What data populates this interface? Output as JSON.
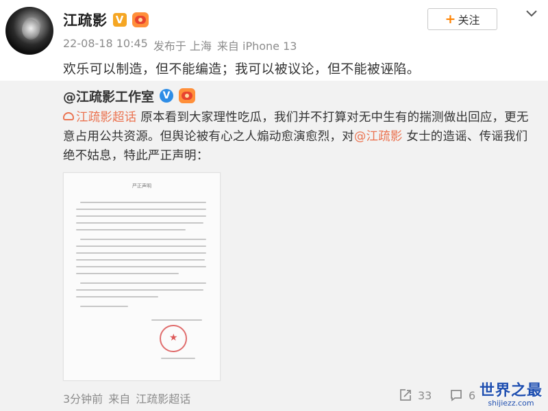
{
  "post": {
    "author": "江疏影",
    "verified_icon": "orange-v-badge",
    "level_icon": "svip-badge",
    "date": "22-08-18 10:45",
    "posted_from": "发布于 上海",
    "device": "来自 iPhone 13",
    "text": "欢乐可以制造，但不能编造；我可以被议论，但不能被诬陷。",
    "follow_label": "关注",
    "menu_icon": "chevron-down-icon"
  },
  "repost": {
    "author": "@江疏影工作室",
    "verified_icon": "blue-v-badge",
    "topic": "江疏影超话",
    "text_part1": " 原本看到大家理性吃瓜，我们并不打算对无中生有的揣测做出回应，更无意占用公共资源。但舆论被有心之人煽动愈演愈烈，对",
    "mention": "@江疏影",
    "text_part2": " 女士的造谣、传谣我们绝不姑息，特此严正声明：",
    "doc_title": "严正声明",
    "footer_time": "3分钟前",
    "footer_from": "来自",
    "footer_source": "江疏影超话",
    "share_count": "33",
    "comment_count": "6"
  },
  "watermark": {
    "main": "世界之最",
    "sub": "shijiezz.com"
  }
}
